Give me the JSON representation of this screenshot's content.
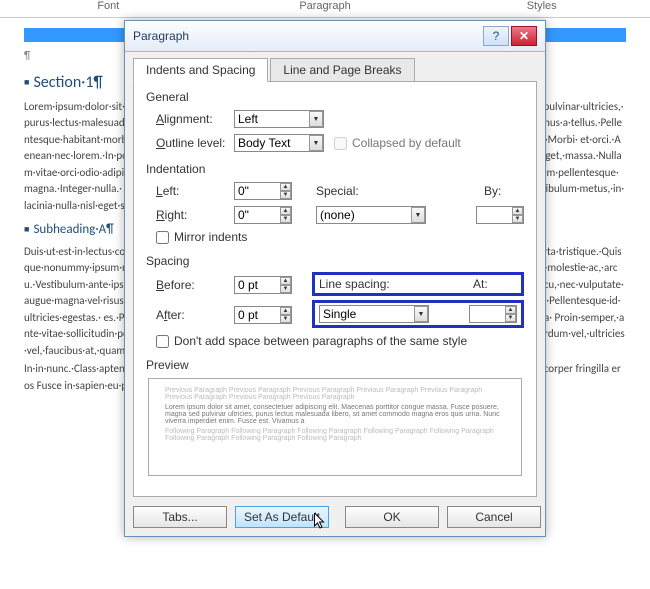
{
  "ribbon": {
    "groups": [
      "Font",
      "Paragraph",
      "Styles"
    ]
  },
  "doc": {
    "section1_heading": "Section·1¶",
    "section1_body": "Lorem·ipsum·dolor·sit·amet·consectetuer·congue·nulla·viverra·interdum·semper·lacinia.·Fusce· posuere,·magna·sed·pulvinar·ultricies,·purus·lectus·malesuada·libero,·vitae·commodo·magna·eros· quis·urna.·Nunc·viverra·imperdiet·enim.·Fusce·est.·Vivamus·a·tellus.·Pellentesque·habitant·morbi· tristique·senectus·et·netus·et·malesuada·fames·ac·turpis·egestas.·Vestibulum·at·velit·purus.·Morbi· et·orci.·Aenean·nec·lorem.·In·porttitor.·Donec·laoreet·nonummy·augue.·Curabitur·eu·purus·a·urna· scelerisque·at,·vulputate·eget,·massa.·Nullam·vitae·orci·odio·adipiscing·varius·et·eleifend.·Ut· nonummy.·Fusce·aliquet·pede·non·pede.·Suspendisse·dapibus·lorem·pellentesque·magna.·Integer·nulla.· Donec·blandit·feugiat·ligula·et·ultrices·sem.·Morbi·posuere·luctus·sed·orci·varius·natoque·vestibulum·metus,·in· lacinia·nulla·nisl·eget·sapien.·Cras·ornare·Nam·vel·justo.¶",
    "subA_heading": "Subheading·A¶",
    "subA_body": "Duis·ut·est·in·lectus·consequat·consequat.·Vivamus·a·tellus.·Pellentesque·habitant·morbi·tristique·volutpat·nunc· porta·tristique.·Quisque·nonummy·ipsum·non·arcu.·Vivamus·sit·amet·lorem·posuere·dui·ornare·morbi·tristique· vulputate·vel,·auctor·ac,·molestie·ac,·arcu.·Vestibulum·ante·ipsum·primis·in·faucibus·orci·luctus·et·porttitor,·velit· lacinia·egestas·auctor,·diam·eros·tempus·arcu,·nec·vulputate·augue·magna·vel·risus.·Cras·non·magna· ante·adipiscing·id,·lacinia·sit·amet,·amet,·interdum·placerat,·pede·ut·massa.·Pellentesque·id·ultricies·egestas.· es.·Pellentesque·condimentum,·magna·ut·suscipit·hendrerit,·ipsum·augue·ornare·nulla,·nunc·massa· Proin·semper,·ante·vitae·sollicitudin·posuere,·metus·quam·iaculis·nibh,·vitae·scelerisque·nunc·massa· eget·pede.·Sed·velit·urna,·interdum·vel,·ultricies·vel,·faucibus·at,·quam.·Donec·elit·est,·consectetuer· eget,·consequat·quis,·tempus·quis,·wisi.¶",
    "footer_body": "In·in·nunc.·Class·aptent·taciti·sociosqu·ad·litora·torquent·per·conubia·nostra,·per·inceptos·hymenaeos.· Donec ullamcorper fringilla eros Fusce in·sapien·eu·purus·dapibus·commodo Cum·sociis·natoque"
  },
  "dialog": {
    "title": "Paragraph",
    "tabs": {
      "t1": "Indents and Spacing",
      "t2": "Line and Page Breaks"
    },
    "general": {
      "title": "General",
      "alignment_label": "Alignment:",
      "alignment_value": "Left",
      "outline_label": "Outline level:",
      "outline_value": "Body Text",
      "collapsed_label": "Collapsed by default"
    },
    "indent": {
      "title": "Indentation",
      "left_label": "Left:",
      "left_value": "0\"",
      "right_label": "Right:",
      "right_value": "0\"",
      "special_label": "Special:",
      "special_value": "(none)",
      "by_label": "By:",
      "by_value": "",
      "mirror_label": "Mirror indents"
    },
    "spacing": {
      "title": "Spacing",
      "before_label": "Before:",
      "before_value": "0 pt",
      "after_label": "After:",
      "after_value": "0 pt",
      "line_label": "Line spacing:",
      "line_value": "Single",
      "at_label": "At:",
      "at_value": "",
      "nospace_label": "Don't add space between paragraphs of the same style"
    },
    "preview": {
      "title": "Preview",
      "prev": "Previous Paragraph Previous Paragraph Previous Paragraph Previous Paragraph Previous Paragraph Previous Paragraph Previous Paragraph Previous Paragraph",
      "mid": "Lorem ipsum dolor sit amet, consectetuer adipiscing elit. Maecenas porttitor congue massa. Fusce posuere, magna sed pulvinar ultricies, purus lectus malesuada libero, sit amet commodo magna eros quis urna. Nunc viverra imperdiet enim. Fusce est. Vivamus a",
      "next": "Following Paragraph Following Paragraph Following Paragraph Following Paragraph Following Paragraph Following Paragraph Following Paragraph Following Paragraph"
    },
    "buttons": {
      "tabs": "Tabs...",
      "default": "Set As Default",
      "ok": "OK",
      "cancel": "Cancel"
    }
  }
}
